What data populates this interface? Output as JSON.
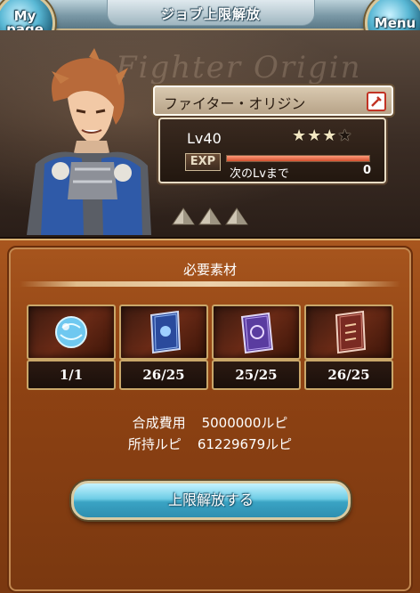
{
  "header": {
    "title": "ジョブ上限解放",
    "mypage_line1": "My",
    "mypage_line2": "page",
    "menu_label": "Menu"
  },
  "hero": {
    "watermark": "Fighter Origin",
    "class_name": "ファイター・オリジン",
    "weapon_icon": "sword-icon",
    "level": "Lv40",
    "stars_total": 4,
    "stars_filled": 3,
    "exp_label": "EXP",
    "exp_progress": 1.0,
    "next_label": "次のLvまで",
    "next_value": "0"
  },
  "materials": {
    "title": "必要素材",
    "items": [
      {
        "icon": "blue-orb-icon",
        "count": "1/1"
      },
      {
        "icon": "blue-tome-icon",
        "count": "26/25"
      },
      {
        "icon": "purple-tome-icon",
        "count": "25/25"
      },
      {
        "icon": "red-tome-icon",
        "count": "26/25"
      }
    ],
    "cost_label": "合成費用",
    "cost_value": "5000000ルピ",
    "owned_label": "所持ルピ",
    "owned_value": "61229679ルピ",
    "unlock_button": "上限解放する"
  },
  "colors": {
    "panel": "#8e4213",
    "accent_blue": "#6fcde6",
    "exp_fill": "#d4502e",
    "gold_border": "#c9a76a"
  }
}
